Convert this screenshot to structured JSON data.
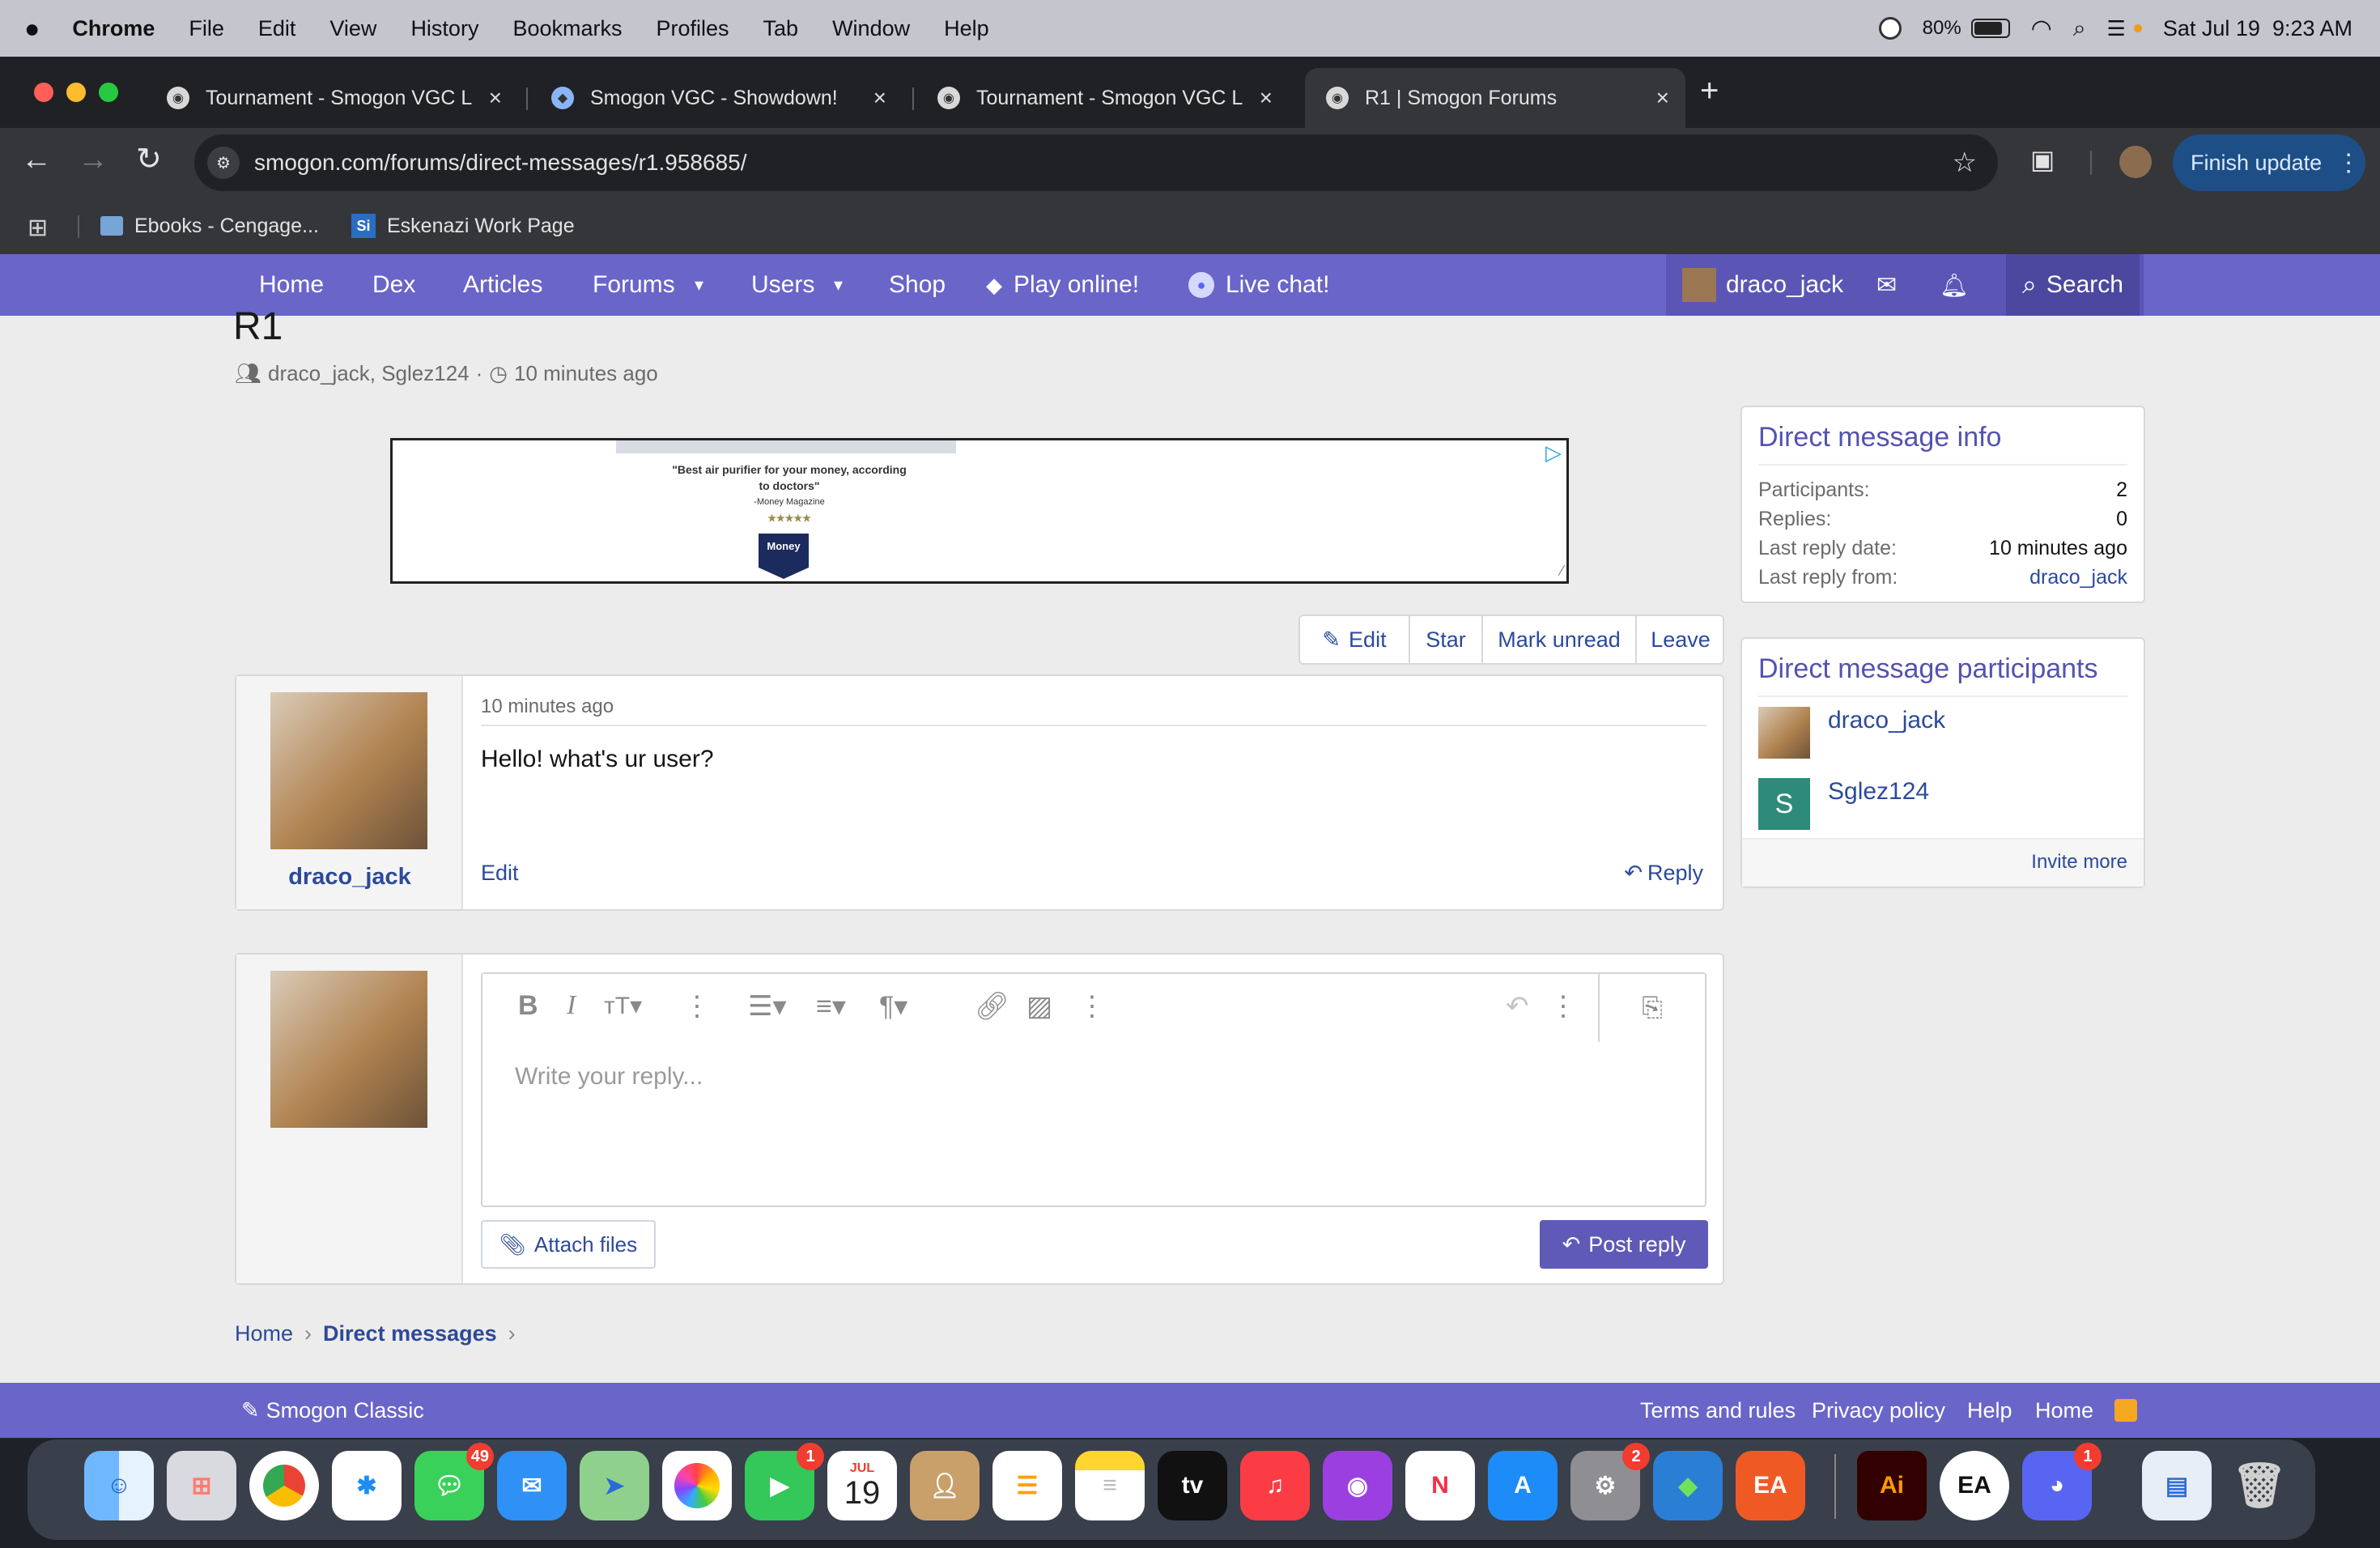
{
  "menubar": {
    "app": "Chrome",
    "items": [
      "File",
      "Edit",
      "View",
      "History",
      "Bookmarks",
      "Profiles",
      "Tab",
      "Window",
      "Help"
    ],
    "battery": "80%",
    "clock": "Sat Jul 19  9:23 AM"
  },
  "tabs": [
    {
      "title": "Tournament - Smogon VGC L"
    },
    {
      "title": "Smogon VGC - Showdown!"
    },
    {
      "title": "Tournament - Smogon VGC L"
    },
    {
      "title": "R1 | Smogon Forums"
    }
  ],
  "toolbar": {
    "url": "smogon.com/forums/direct-messages/r1.958685/",
    "finish_update": "Finish update"
  },
  "bookmarks": [
    {
      "label": "Ebooks - Cengage..."
    },
    {
      "label": "Eskenazi Work Page"
    }
  ],
  "sitenav": {
    "home": "Home",
    "dex": "Dex",
    "articles": "Articles",
    "forums": "Forums",
    "users": "Users",
    "shop": "Shop",
    "play": "Play online!",
    "chat": "Live chat!",
    "username": "draco_jack",
    "search": "Search"
  },
  "thread": {
    "title": "R1",
    "participants": "draco_jack, Sglez124",
    "time": "10 minutes ago"
  },
  "ad": {
    "quote": "\"Best air purifier for your money, according to doctors\"",
    "source": "-Money Magazine",
    "stars": "★★★★★",
    "badge": "Money"
  },
  "actions": {
    "edit": "Edit",
    "star": "Star",
    "mark_unread": "Mark unread",
    "leave": "Leave"
  },
  "message": {
    "author": "draco_jack",
    "time": "10 minutes ago",
    "body": "Hello! what's ur user?",
    "edit": "Edit",
    "reply": "Reply"
  },
  "editor": {
    "placeholder": "Write your reply...",
    "attach": "Attach files",
    "post": "Post reply"
  },
  "info": {
    "title": "Direct message info",
    "participants_label": "Participants:",
    "participants_value": "2",
    "replies_label": "Replies:",
    "replies_value": "0",
    "last_date_label": "Last reply date:",
    "last_date_value": "10 minutes ago",
    "last_from_label": "Last reply from:",
    "last_from_value": "draco_jack"
  },
  "participants_card": {
    "title": "Direct message participants",
    "p1": "draco_jack",
    "p2": "Sglez124",
    "p2_initial": "S",
    "invite": "Invite more"
  },
  "breadcrumb": {
    "home": "Home",
    "dm": "Direct messages"
  },
  "footer": {
    "classic": "Smogon Classic",
    "terms": "Terms and rules",
    "privacy": "Privacy policy",
    "help": "Help",
    "home": "Home"
  },
  "dock": {
    "messages_badge": "49",
    "facetime_badge": "1",
    "calendar_month": "JUL",
    "calendar_day": "19",
    "settings_badge": "2",
    "discord_badge": "1",
    "tv_label": "tv",
    "ai_label": "Ai"
  }
}
